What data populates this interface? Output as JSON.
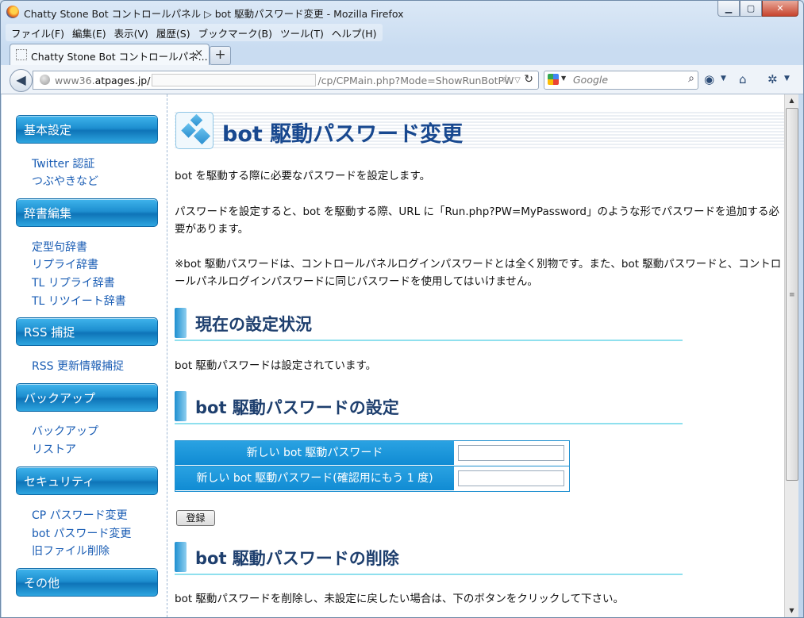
{
  "window": {
    "title": "Chatty Stone Bot コントロールパネル ▷ bot 駆動パスワード変更 - Mozilla Firefox"
  },
  "menu": [
    "ファイル(F)",
    "編集(E)",
    "表示(V)",
    "履歴(S)",
    "ブックマーク(B)",
    "ツール(T)",
    "ヘルプ(H)"
  ],
  "tab": {
    "title": "Chatty Stone Bot コントロールパネ...",
    "close": "×",
    "new_tab": "+"
  },
  "nav": {
    "url_prefix": "www36.",
    "url_domain": "atpages.jp/",
    "url_suffix": "/cp/CPMain.php?Mode=ShowRunBotPW",
    "search_placeholder": "Google"
  },
  "sidebar": [
    {
      "heading": "基本設定",
      "links": [
        "Twitter 認証",
        "つぶやきなど"
      ]
    },
    {
      "heading": "辞書編集",
      "links": [
        "定型句辞書",
        "リプライ辞書",
        "TL リプライ辞書",
        "TL リツイート辞書"
      ]
    },
    {
      "heading": "RSS 捕捉",
      "links": [
        "RSS 更新情報捕捉"
      ]
    },
    {
      "heading": "バックアップ",
      "links": [
        "バックアップ",
        "リストア"
      ]
    },
    {
      "heading": "セキュリティ",
      "links": [
        "CP パスワード変更",
        "bot パスワード変更",
        "旧ファイル削除"
      ]
    },
    {
      "heading": "その他",
      "links": []
    }
  ],
  "main": {
    "page_title": "bot 駆動パスワード変更",
    "intro1": "bot を駆動する際に必要なパスワードを設定します。",
    "intro2": "パスワードを設定すると、bot を駆動する際、URL に「Run.php?PW=MyPassword」のような形でパスワードを追加する必要があります。",
    "intro3": "※bot 駆動パスワードは、コントロールパネルログインパスワードとは全く別物です。また、bot 駆動パスワードと、コントロールパネルログインパスワードに同じパスワードを使用してはいけません。",
    "section1_title": "現在の設定状況",
    "status_text": "bot 駆動パスワードは設定されています。",
    "section2_title": "bot 駆動パスワードの設定",
    "new_pw_label": "新しい bot 駆動パスワード",
    "confirm_pw_label": "新しい bot 駆動パスワード(確認用にもう 1 度)",
    "submit_label": "登録",
    "section3_title": "bot 駆動パスワードの削除",
    "delete_text": "bot 駆動パスワードを削除し、未設定に戻したい場合は、下のボタンをクリックして下さい。"
  }
}
